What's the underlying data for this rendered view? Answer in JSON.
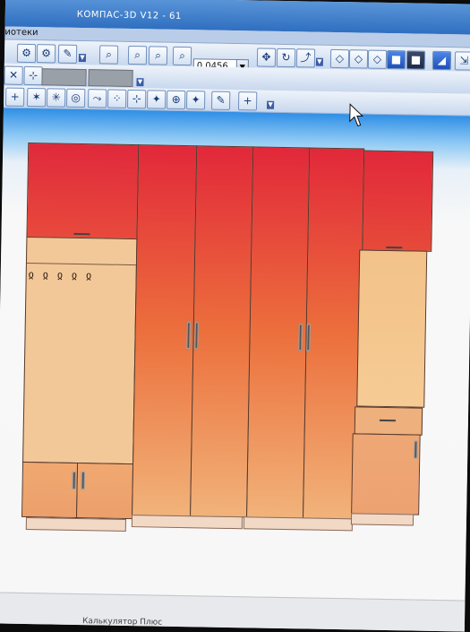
{
  "window": {
    "title": "КОМПАС-3D V12 - 61"
  },
  "menu": {
    "label": "иотеки"
  },
  "toolbar": {
    "zoom_value": "0.0456"
  },
  "taskbar": {
    "calculator_label": "Калькулятор Плюс"
  },
  "colors": {
    "title_bar": "#2f6fc0",
    "toolbar_bg": "#dbe6f4",
    "door_top": "#e2283a",
    "door_bottom": "#f1b37a",
    "canvas_bg": "#f7f7f7"
  }
}
